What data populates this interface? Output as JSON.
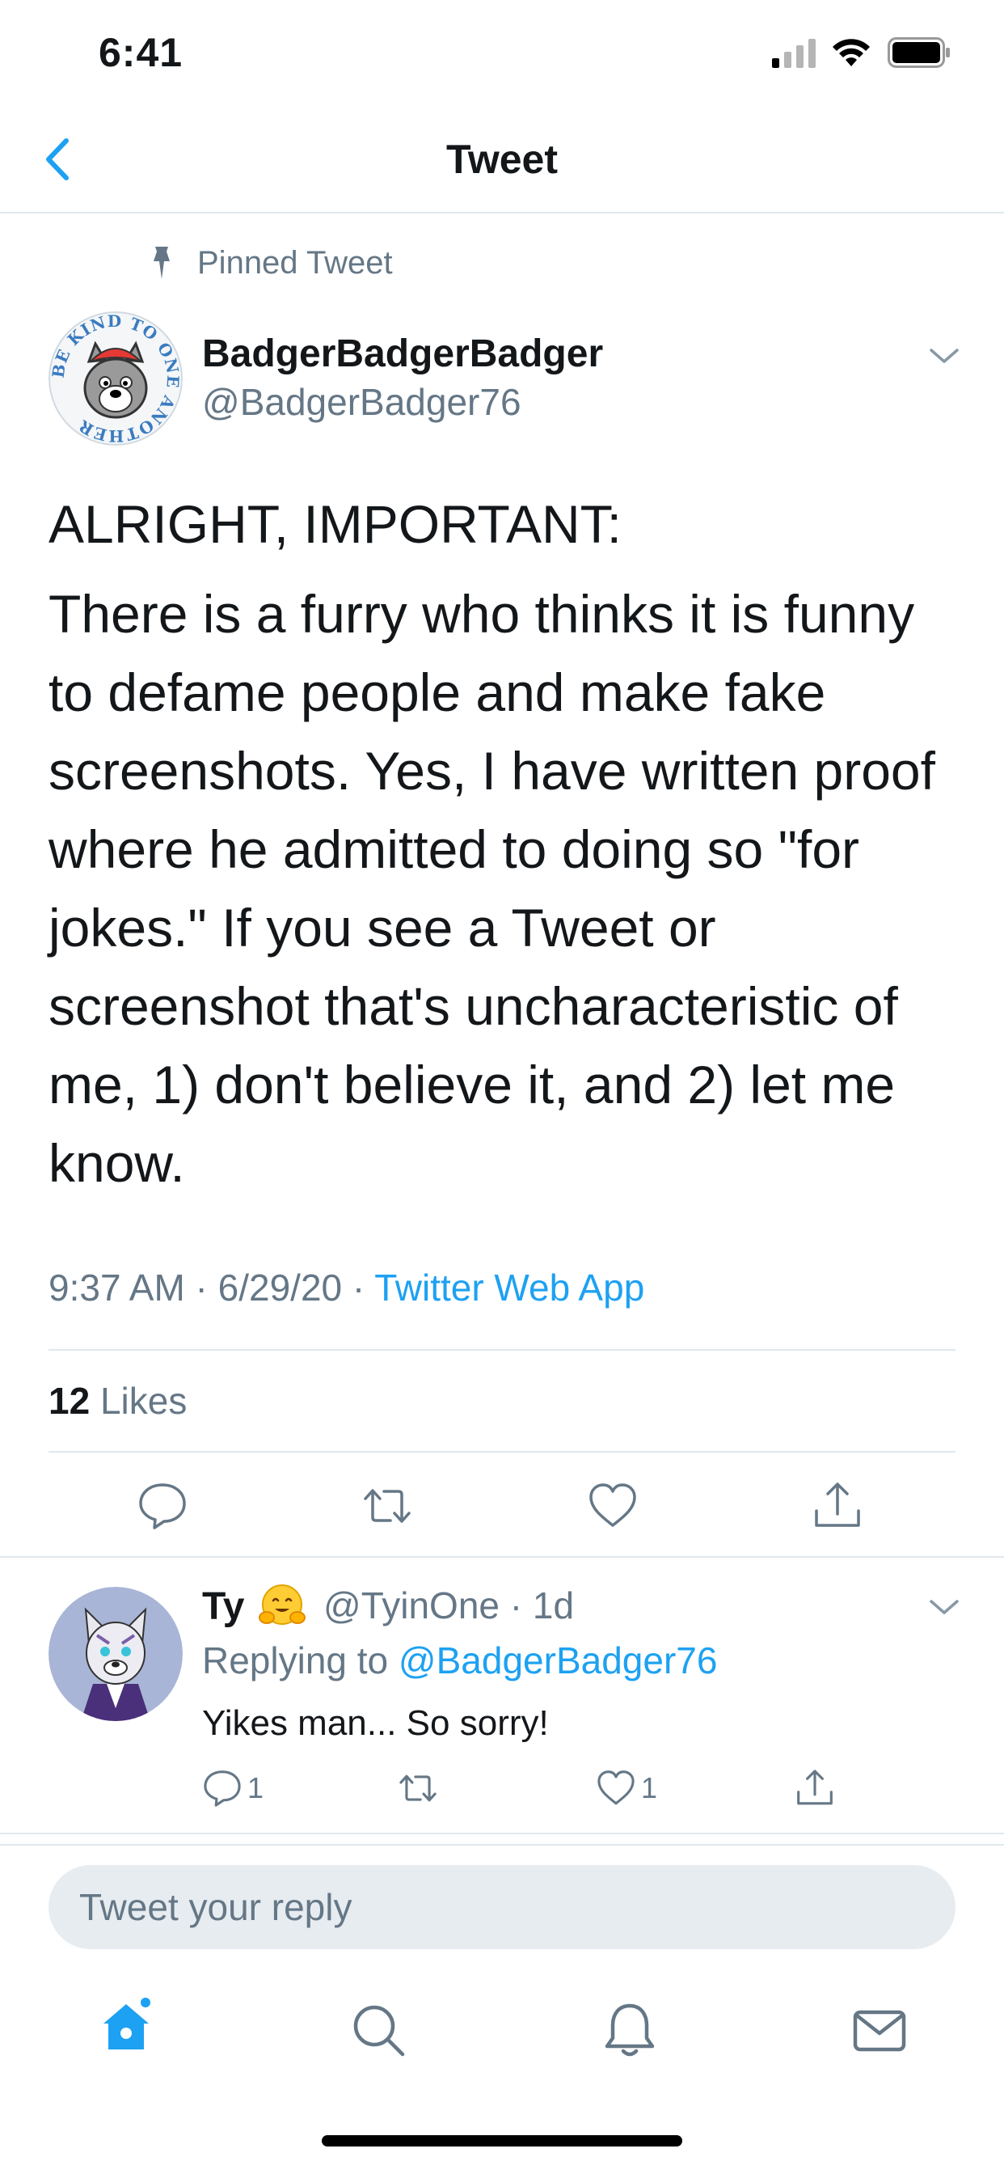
{
  "status_bar": {
    "time": "6:41"
  },
  "nav": {
    "title": "Tweet"
  },
  "tweet": {
    "pinned_label": "Pinned Tweet",
    "author_name": "BadgerBadgerBadger",
    "author_handle": "@BadgerBadger76",
    "text_paragraphs": [
      "ALRIGHT, IMPORTANT:",
      "There is a furry who thinks it is funny to defame people and make fake screenshots. Yes, I have written proof where he admitted to doing so \"for jokes.\" If you see a Tweet or screenshot that's uncharacteristic of me, 1) don't believe it, and 2) let me know."
    ],
    "timestamp": "9:37 AM · 6/29/20 · ",
    "source": "Twitter Web App",
    "likes_count": "12",
    "likes_label": "Likes",
    "avatar_text": "BE KIND TO ONE ANOTHER"
  },
  "reply": {
    "name": "Ty",
    "handle_time": "@TyinOne · 1d",
    "replying_prefix": "Replying to ",
    "replying_to": "@BadgerBadger76",
    "text": "Yikes man... So sorry!",
    "reply_count": "1",
    "like_count": "1"
  },
  "composer": {
    "placeholder": "Tweet your reply"
  },
  "tabs": [
    "home-icon",
    "search-icon",
    "notifications-icon",
    "messages-icon"
  ],
  "colors": {
    "accent": "#1da1f2",
    "secondary_text": "#657786",
    "divider": "#e1e8ed"
  }
}
